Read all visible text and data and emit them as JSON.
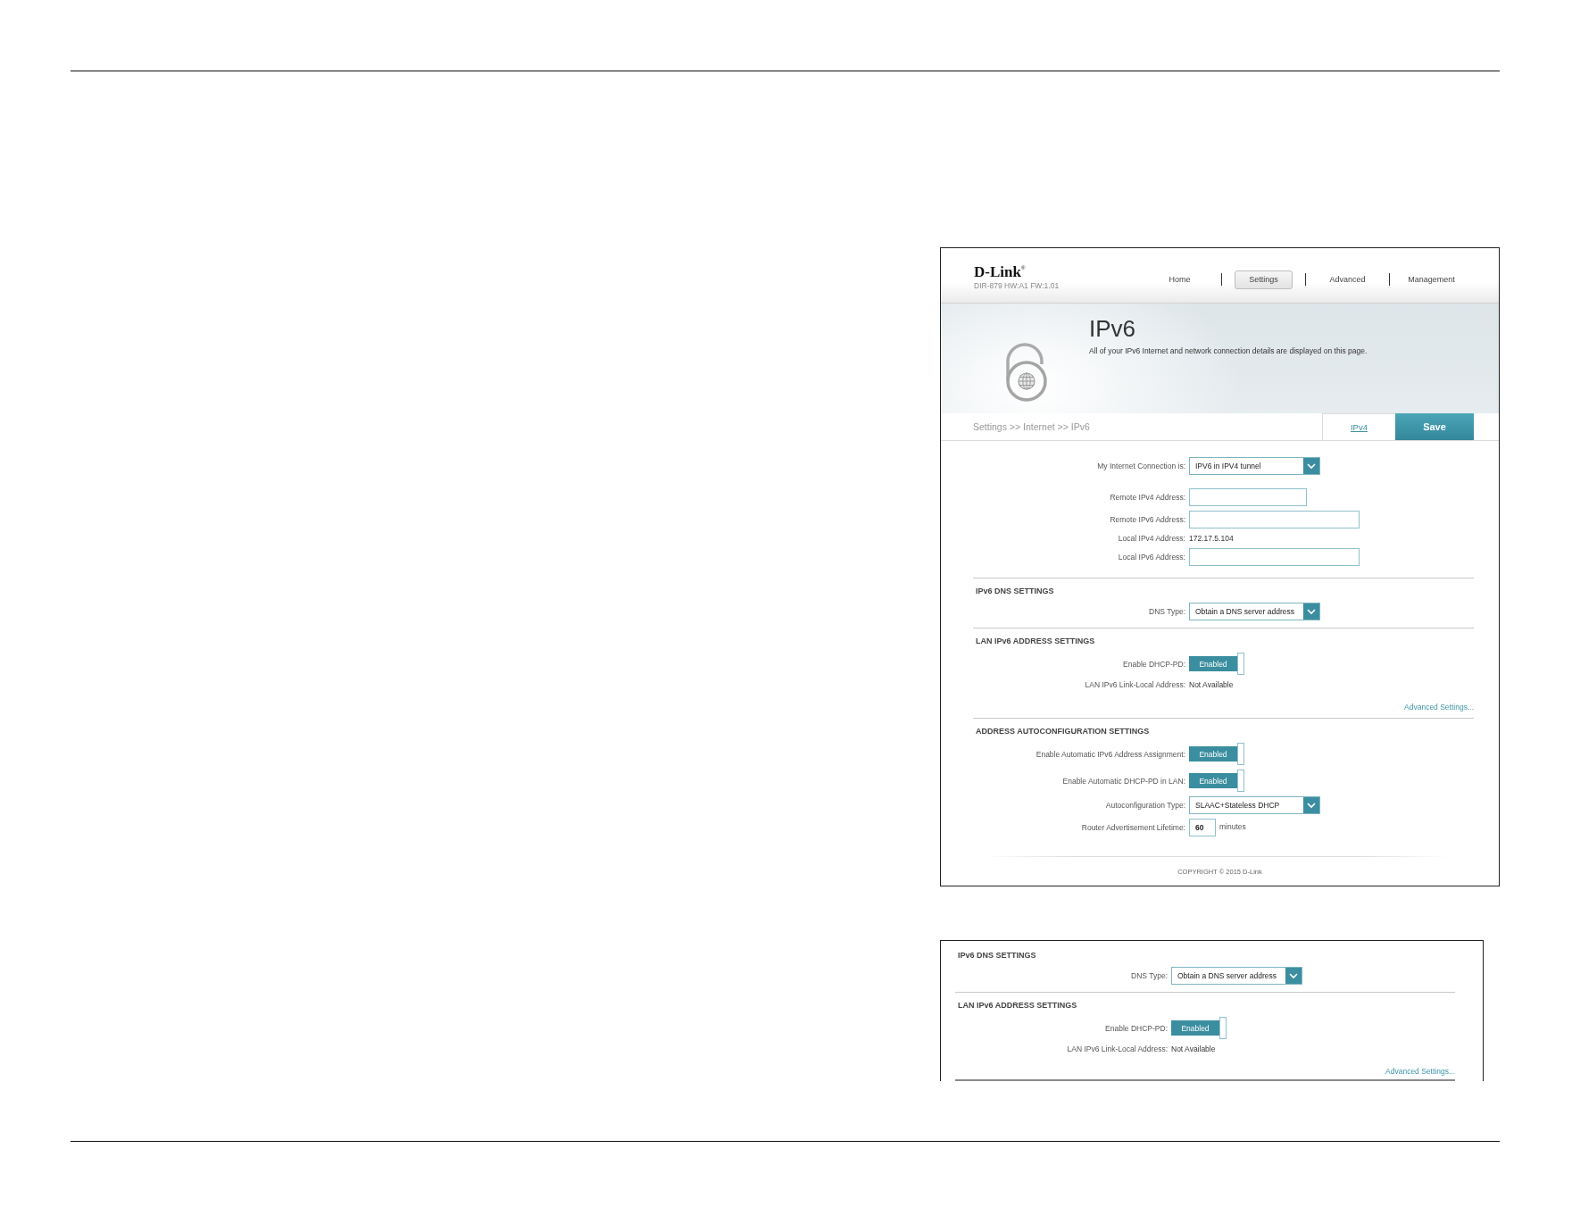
{
  "screenshot": {
    "brand": "D-Link$^{®}$",
    "model_info": "DIR-879 HW:A1 FW:1.01",
    "nav": [
      {
        "label": "Home",
        "selected": false
      },
      {
        "label": "Settings",
        "selected": true
      },
      {
        "label": "Advanced",
        "selected": false
      },
      {
        "label": "Management",
        "selected": false
      }
    ],
    "hero": {
      "title": "IPv6",
      "description": "All of your IPv6 Internet and network connection details are displayed on this page."
    },
    "breadcrumb": "Settings >> Internet >> IPv6",
    "ipv4_link": "IPv4",
    "save_button": "Save",
    "sections": [
      {
        "fields": [
          {
            "kind": "select",
            "label": "My Internet Connection is:",
            "value": "IPV6 in IPV4 tunnel"
          },
          {
            "kind": "input",
            "label": "Remote IPv4 Address:"
          },
          {
            "kind": "input",
            "label": "Remote IPv6 Address:"
          },
          {
            "kind": "text",
            "label": "Local IPv4 Address:",
            "value": "172.17.5.104"
          },
          {
            "kind": "input",
            "label": "Local IPv6 Address:"
          }
        ]
      },
      {
        "heading": "IPv6 DNS SETTINGS",
        "fields": [
          {
            "kind": "select",
            "label": "DNS Type:",
            "value": "Obtain a DNS server address"
          }
        ]
      },
      {
        "heading": "LAN IPv6 ADDRESS SETTINGS",
        "fields": [
          {
            "kind": "toggle",
            "label": "Enable DHCP-PD:",
            "value": "Enabled",
            "on": true
          },
          {
            "kind": "text",
            "label": "LAN IPv6 Link-Local Address:",
            "value": "Not Available"
          }
        ],
        "link": "Advanced Settings..."
      },
      {
        "heading": "ADDRESS AUTOCONFIGURATION SETTINGS",
        "fields": [
          {
            "kind": "toggle",
            "label": "Enable Automatic IPv6 Address Assignment:",
            "value": "Enabled",
            "on": true
          },
          {
            "kind": "toggle",
            "label": "Enable Automatic DHCP-PD in LAN:",
            "value": "Enabled",
            "on": true
          },
          {
            "kind": "select",
            "label": "Autoconfiguration Type:",
            "value": "SLAAC+Stateless DHCP"
          },
          {
            "kind": "number",
            "label": "Router Advertisement Lifetime:",
            "value": "60",
            "unit": "minutes"
          }
        ]
      }
    ],
    "copyright": "COPYRIGHT © 2015 D-Link"
  },
  "inset": {
    "sections": [
      {
        "heading": "IPv6 DNS SETTINGS",
        "fields": [
          {
            "kind": "select",
            "label": "DNS Type:",
            "value": "Obtain a DNS server address"
          }
        ]
      },
      {
        "heading": "LAN IPv6 ADDRESS SETTINGS",
        "fields": [
          {
            "kind": "toggle",
            "label": "Enable DHCP-PD:",
            "value": "Enabled",
            "on": true
          },
          {
            "kind": "text",
            "label": "LAN IPv6 Link-Local Address:",
            "value": "Not Available"
          }
        ],
        "link": "Advanced Settings..."
      }
    ]
  }
}
